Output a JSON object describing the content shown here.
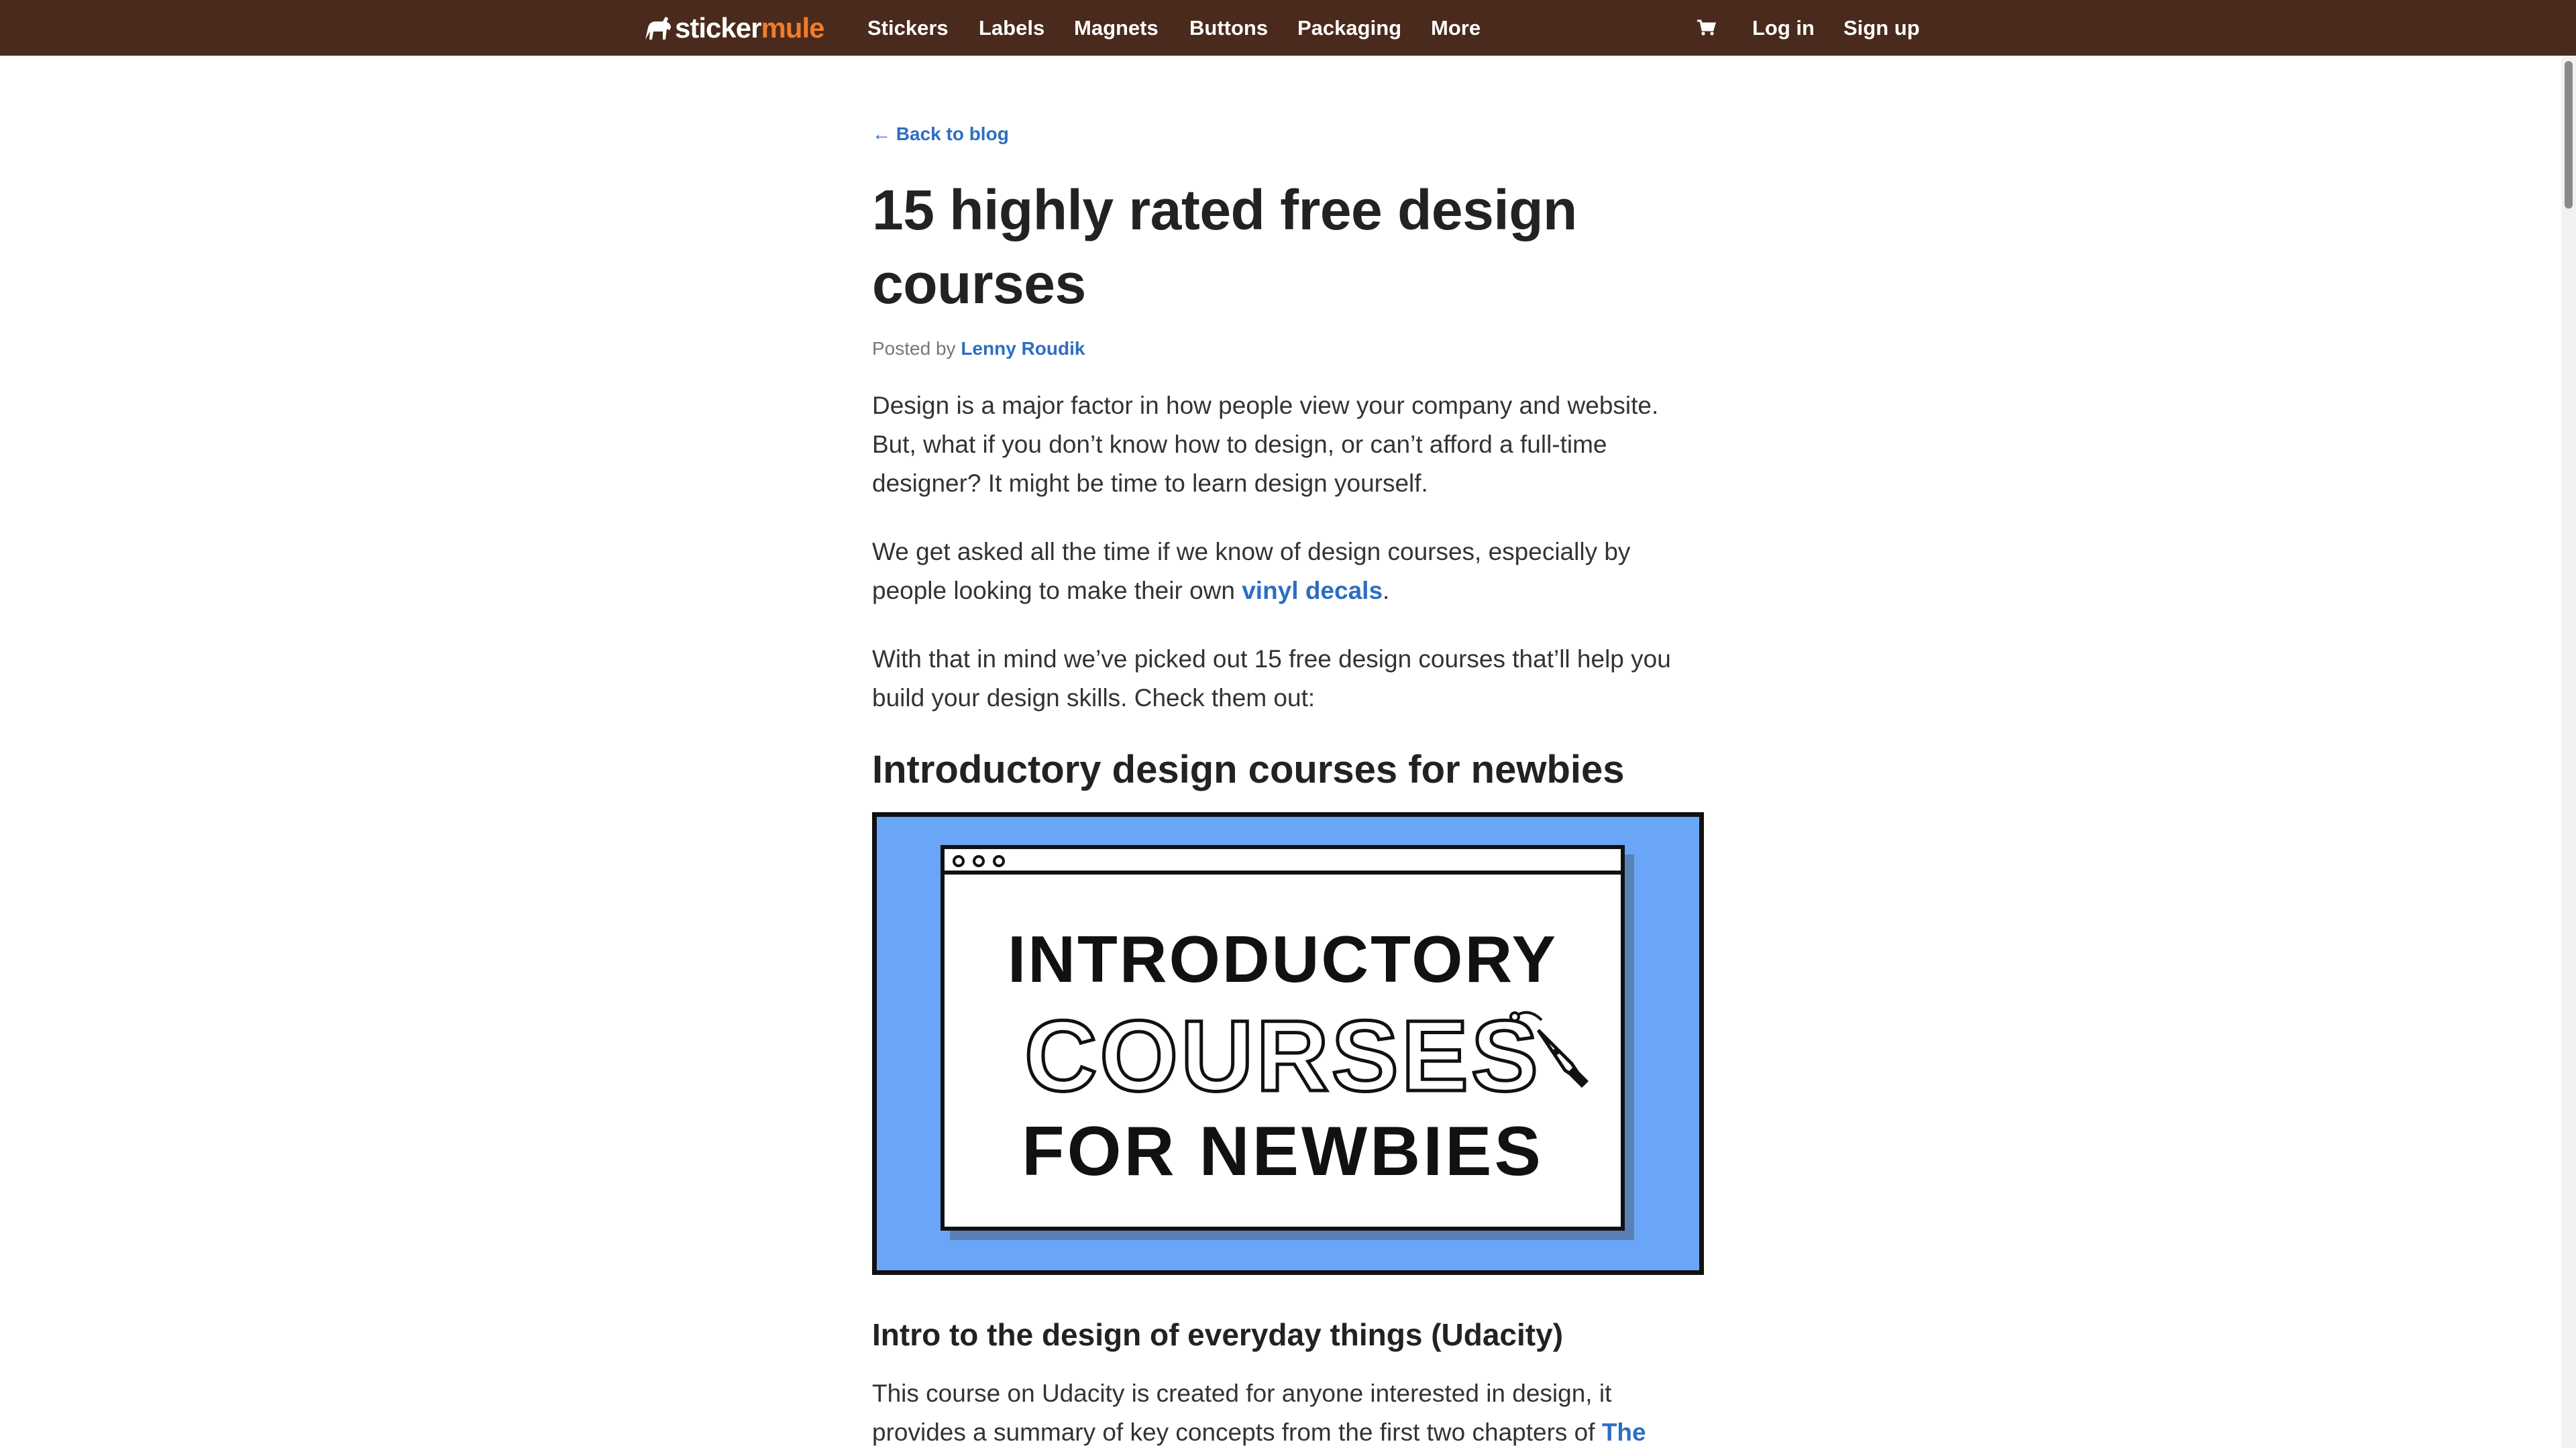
{
  "nav": {
    "logo_part1": "sticker",
    "logo_part2": "mule",
    "items": [
      "Stickers",
      "Labels",
      "Magnets",
      "Buttons",
      "Packaging",
      "More"
    ],
    "login": "Log in",
    "signup": "Sign up",
    "icons": {
      "cart": "cart-icon",
      "logo": "mule-icon"
    }
  },
  "colors": {
    "nav_bg": "#4a2a1c",
    "brand_orange": "#f07c2a",
    "link": "#2d6ec2",
    "hero_bg": "#6aa6f7"
  },
  "article": {
    "back_link": "← Back to blog",
    "title": "15 highly rated free design courses",
    "byline_prefix": "Posted by",
    "author": "Lenny Roudik",
    "p1": "Design is a major factor in how people view your company and website. But, what if you don’t know how to design, or can’t afford a full-time designer? It might be time to learn design yourself.",
    "p2_before": "We get asked all the time if we know of design courses, especially by people looking to make their own ",
    "p2_link": "vinyl decals",
    "p2_after": ".",
    "p3": "With that in mind we’ve picked out 15 free design courses that’ll help you build your design skills. Check them out:",
    "section1_heading": "Introductory design courses for newbies",
    "hero": {
      "line1": "INTRODUCTORY",
      "line2": "COURSES",
      "line3": "FOR NEWBIES"
    },
    "course1_heading": "Intro to the design of everyday things (Udacity)",
    "p4_before": "This course on Udacity is created for anyone interested in design, it provides a summary of key concepts from the first two chapters of ",
    "p4_link": "The"
  }
}
